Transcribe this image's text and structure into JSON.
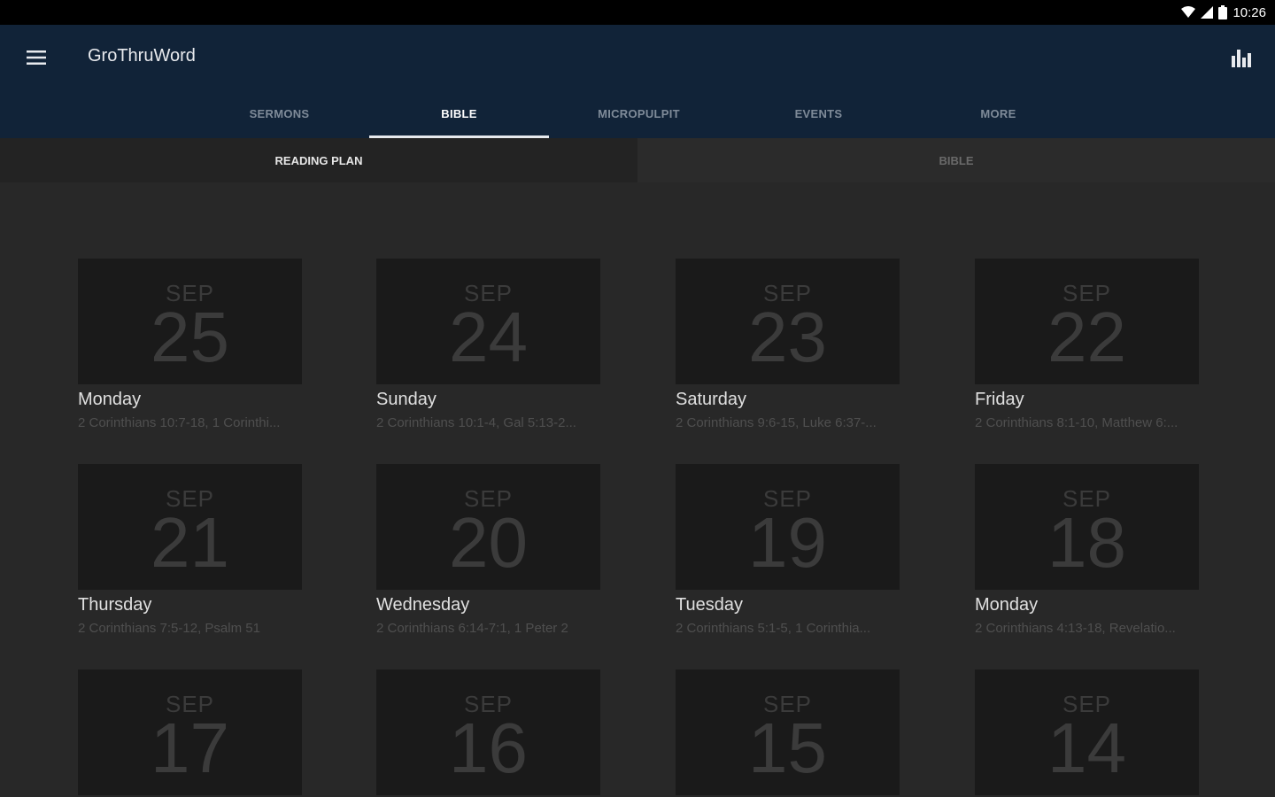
{
  "status": {
    "time": "10:26"
  },
  "appbar": {
    "title": "GroThruWord"
  },
  "tabs": [
    {
      "label": "SERMONS"
    },
    {
      "label": "BIBLE"
    },
    {
      "label": "MICROPULPIT"
    },
    {
      "label": "EVENTS"
    },
    {
      "label": "MORE"
    }
  ],
  "subtabs": [
    {
      "label": "READING PLAN"
    },
    {
      "label": "BIBLE"
    }
  ],
  "readings": [
    {
      "month": "SEP",
      "date": "25",
      "day": "Monday",
      "readings": "2 Corinthians 10:7-18, 1 Corinthi..."
    },
    {
      "month": "SEP",
      "date": "24",
      "day": "Sunday",
      "readings": "2 Corinthians 10:1-4, Gal 5:13-2..."
    },
    {
      "month": "SEP",
      "date": "23",
      "day": "Saturday",
      "readings": "2 Corinthians 9:6-15, Luke 6:37-..."
    },
    {
      "month": "SEP",
      "date": "22",
      "day": "Friday",
      "readings": "2 Corinthians 8:1-10, Matthew 6:..."
    },
    {
      "month": "SEP",
      "date": "21",
      "day": "Thursday",
      "readings": "2 Corinthians 7:5-12, Psalm 51"
    },
    {
      "month": "SEP",
      "date": "20",
      "day": "Wednesday",
      "readings": "2 Corinthians 6:14-7:1, 1 Peter 2"
    },
    {
      "month": "SEP",
      "date": "19",
      "day": "Tuesday",
      "readings": "2 Corinthians 5:1-5, 1 Corinthia..."
    },
    {
      "month": "SEP",
      "date": "18",
      "day": "Monday",
      "readings": "2 Corinthians 4:13-18, Revelatio..."
    },
    {
      "month": "SEP",
      "date": "17",
      "day": "",
      "readings": ""
    },
    {
      "month": "SEP",
      "date": "16",
      "day": "",
      "readings": ""
    },
    {
      "month": "SEP",
      "date": "15",
      "day": "",
      "readings": ""
    },
    {
      "month": "SEP",
      "date": "14",
      "day": "",
      "readings": ""
    }
  ]
}
